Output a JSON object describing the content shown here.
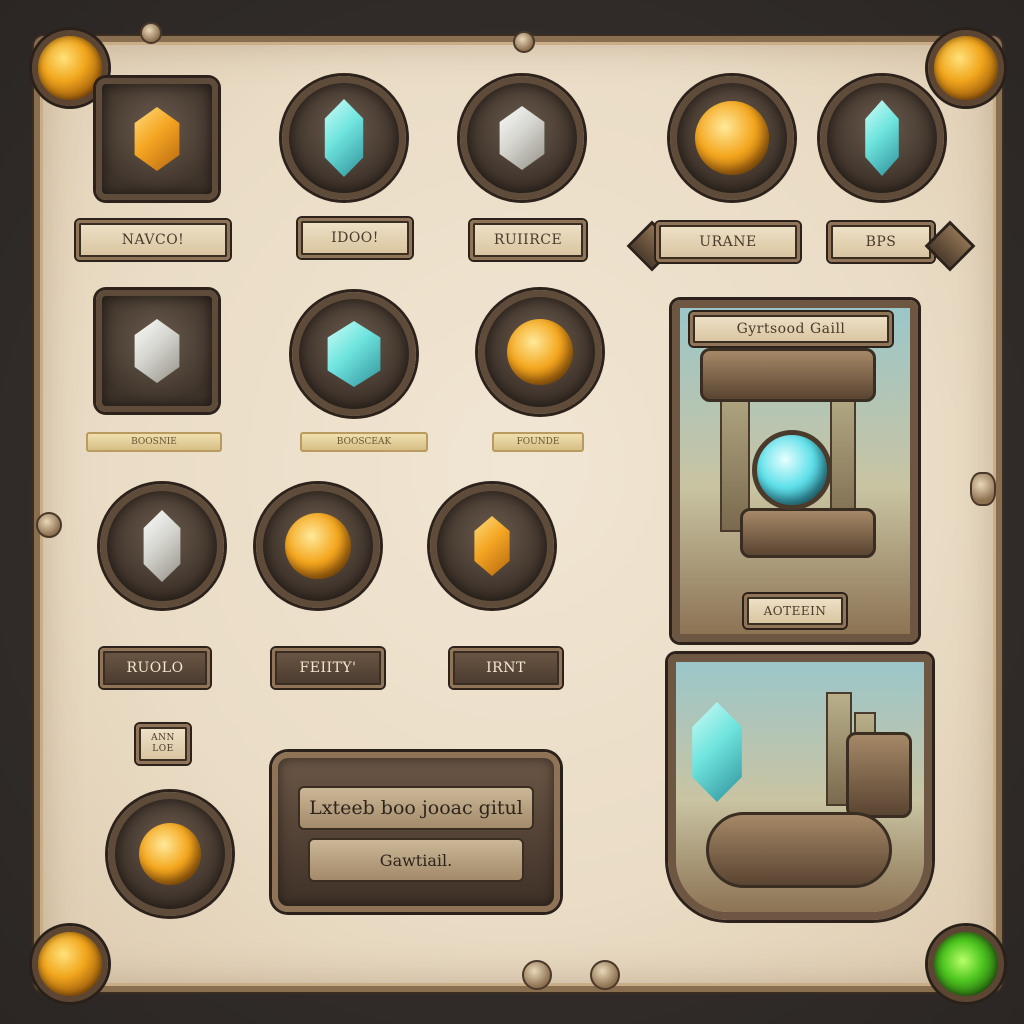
{
  "labels": {
    "row1": [
      "NAVCO!",
      "IDOO!",
      "RUIIRCE",
      "URANE",
      "BPS"
    ],
    "row2": [
      "BOOSNIE",
      "BOOSCEAK",
      "FOUNDE"
    ],
    "row3": [
      "RUOLO",
      "FEIITY'",
      "IRNT"
    ],
    "small_tag": "ANN\nLOE"
  },
  "card1": {
    "title": "Gyrtsood Gaill",
    "footer": "AOTEEIN"
  },
  "banner": {
    "line1": "Lxteeb boo jooac gitul",
    "line2": "Gawtiail."
  },
  "colors": {
    "parchment": "#eadcc5",
    "frame_bronze": "#5e4b39",
    "amber": "#f5a623",
    "cyan": "#6fe4de",
    "green": "#4fc720"
  },
  "icons": {
    "row1": [
      "amber-crystal-icon",
      "cyan-crystal-icon",
      "clear-crystal-icon",
      "amber-orb-icon",
      "cyan-crystal-icon"
    ],
    "row2": [
      "clear-crystal-icon",
      "cyan-fire-crystal-icon",
      "amber-orb-icon"
    ],
    "row3": [
      "clear-crystal-icon",
      "amber-orb-icon",
      "amber-crystal-icon"
    ],
    "row4": [
      "amber-orb-icon"
    ]
  }
}
